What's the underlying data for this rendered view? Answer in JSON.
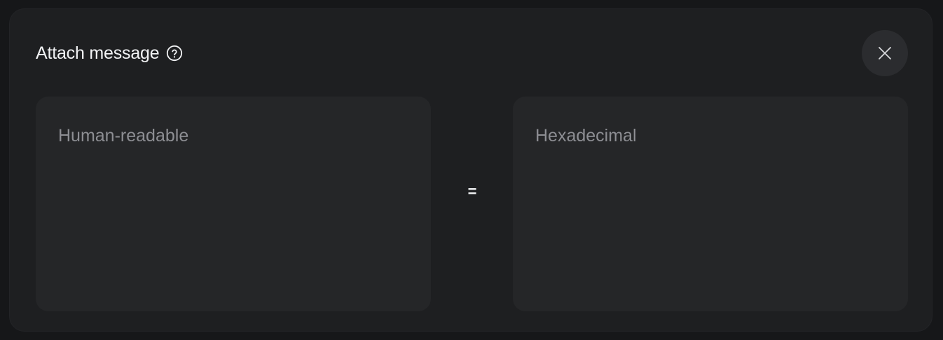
{
  "dialog": {
    "title": "Attach message",
    "help_icon": "question-circle-icon",
    "close_icon": "close-icon"
  },
  "inputs": {
    "human_readable": {
      "value": "",
      "placeholder": "Human-readable"
    },
    "separator": "=",
    "hexadecimal": {
      "value": "",
      "placeholder": "Hexadecimal"
    }
  },
  "colors": {
    "background": "#161719",
    "modal": "#1e1f21",
    "field": "#252628",
    "close_button": "#2b2c2f",
    "text": "#f2f3f5",
    "placeholder": "#8d8e93"
  }
}
